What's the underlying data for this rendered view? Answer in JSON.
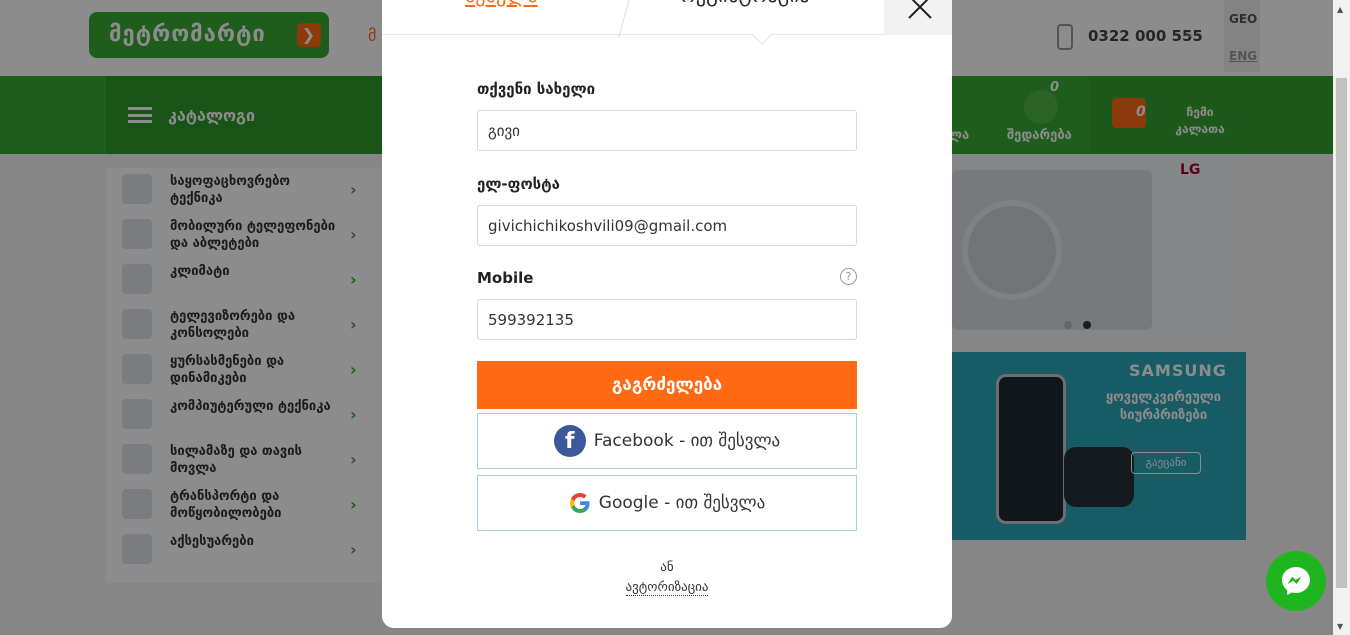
{
  "header": {
    "logo_text": "მეტრომარტი",
    "top_link": "მ",
    "phone": "0322 000 555",
    "languages": [
      "GEO",
      "ENG"
    ]
  },
  "navbar": {
    "catalog_label": "კატალოგი",
    "items": [
      {
        "label": "ლა"
      },
      {
        "label": "შედარება",
        "badge": "0"
      }
    ],
    "cart": {
      "count": "0",
      "label": "ჩემი კალათა"
    }
  },
  "sidebar": {
    "items": [
      {
        "label": "საყოფაცხოვრებო ტექნიკა"
      },
      {
        "label": "მობილური ტელეფონები და აბლეტები"
      },
      {
        "label": "კლიმატი"
      },
      {
        "label": "ტელევიზორები და კონსოლები"
      },
      {
        "label": "ყურსასმენები და დინამიკები"
      },
      {
        "label": "კომპიუტერული ტექნიკა"
      },
      {
        "label": "სილამაზე და თავის მოვლა"
      },
      {
        "label": "ტრანსპორტი და მოწყობილობები"
      },
      {
        "label": "აქსესუარები"
      }
    ]
  },
  "banners": {
    "lg": {
      "brand": "LG"
    },
    "samsung": {
      "brand": "SAMSUNG",
      "promo": "ყოველკვირეული სიურპრიზები",
      "button": "გაეცანი"
    }
  },
  "modal": {
    "tabs": {
      "login": "შესვლა",
      "register": "რეგისტრაცია"
    },
    "fields": {
      "name": {
        "label": "თქვენი სახელი",
        "value": "გივი"
      },
      "email": {
        "label": "ელ-ფოსტა",
        "value": "givichichikoshvili09@gmail.com"
      },
      "mobile": {
        "label": "Mobile",
        "value": "599392135",
        "help": "?"
      }
    },
    "continue_button": "გაგრძელება",
    "facebook_button": "Facebook - ით შესვლა",
    "google_button": "Google - ით შესვლა",
    "or_text": "ან",
    "auth_link": "ავტორიზაცია"
  }
}
